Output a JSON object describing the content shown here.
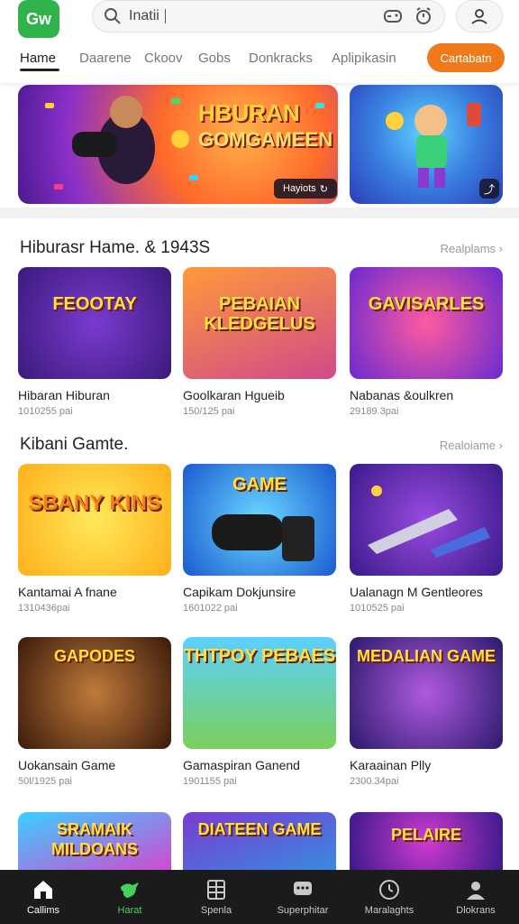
{
  "header": {
    "logo_text": "Gw",
    "search": {
      "value": "Inatii"
    },
    "tabs": [
      "Hame",
      "Daarene",
      "Ckoov",
      "Gobs",
      "Donkracks",
      "Aplipikasin"
    ],
    "cta_label": "Cartabatn"
  },
  "banners": [
    {
      "title": "HBURAN",
      "subtitle": "GOMGAMEEN",
      "badge": "Hayiots"
    }
  ],
  "sections": [
    {
      "title": "Hiburasr Hame. & 1943S",
      "link": "Realplams",
      "cards": [
        {
          "thumb_text": "FEOOTAY",
          "title": "Hibaran Hiburan",
          "meta": "1010255 pai"
        },
        {
          "thumb_text": "PEBAIAN KLEDGELUS",
          "title": "Goolkaran Hgueib",
          "meta": "150/125 pai"
        },
        {
          "thumb_text": "GAVISARLES",
          "title": "Nabanas &oulkren",
          "meta": "29189.3pai"
        }
      ]
    },
    {
      "title": "Kibani Gamte.",
      "link": "Realoiame",
      "cards": [
        {
          "thumb_text": "SBANY KINS",
          "title": "Kantamai A fnane",
          "meta": "1310436pai"
        },
        {
          "thumb_text": "GAME",
          "title": "Capikam Dokjunsire",
          "meta": "1601022 pai"
        },
        {
          "thumb_text": "",
          "title": "Ualanagn M Gentleores",
          "meta": "1010525 pai"
        }
      ]
    },
    {
      "title": "",
      "link": "",
      "cards": [
        {
          "thumb_text": "GAPODES",
          "title": "Uokansain Game",
          "meta": "50l/1925 pai"
        },
        {
          "thumb_text": "THTPOY PEBAES",
          "title": "Gamaspiran Ganend",
          "meta": "1901155 pai"
        },
        {
          "thumb_text": "MEDALIAN GAME",
          "title": "Karaainan Plly",
          "meta": "2300.34pai"
        }
      ]
    },
    {
      "title": "",
      "link": "",
      "cards": [
        {
          "thumb_text": "SRAMAIK MILDOANS",
          "title": "",
          "meta": ""
        },
        {
          "thumb_text": "DIATEEN GAME",
          "title": "",
          "meta": ""
        },
        {
          "thumb_text": "PELAIRE",
          "title": "",
          "meta": ""
        }
      ]
    }
  ],
  "bottom_nav": [
    {
      "label": "Callims",
      "icon": "home-icon"
    },
    {
      "label": "Harat",
      "icon": "bird-icon"
    },
    {
      "label": "Spenla",
      "icon": "grid-icon"
    },
    {
      "label": "Superphitar",
      "icon": "chat-icon"
    },
    {
      "label": "Maralaghts",
      "icon": "clock-icon"
    },
    {
      "label": "Dlokrans",
      "icon": "person-icon"
    }
  ]
}
